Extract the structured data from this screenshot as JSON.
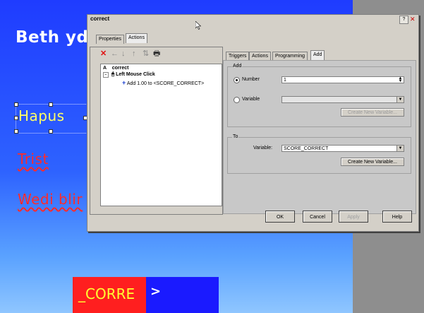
{
  "slide": {
    "title": "Beth ydy",
    "answers": [
      "Hapus",
      "Trist",
      "Wedi blir"
    ],
    "feedback_red": "_CORRE",
    "feedback_blue": ">"
  },
  "dialog": {
    "title": "correct",
    "help_glyph": "?",
    "close_glyph": "✕",
    "outer_tabs": [
      "Properties",
      "Actions"
    ],
    "toolbar_icons": [
      {
        "icon": "delete-x-icon",
        "glyph": "✕"
      },
      {
        "icon": "arrow-left-icon",
        "glyph": "←"
      },
      {
        "icon": "arrow-down-icon",
        "glyph": "↓"
      },
      {
        "icon": "arrow-up-icon",
        "glyph": "↑"
      },
      {
        "icon": "move-icon",
        "glyph": "⇅"
      },
      {
        "icon": "print-icon",
        "glyph": "🖶"
      }
    ],
    "tree": {
      "root_letter": "A",
      "root_label": "correct",
      "event_label": "Left Mouse Click",
      "action_label": "Add 1.00 to <SCORE_CORRECT>"
    },
    "inner_tabs": [
      "Triggers",
      "Actions",
      "Programming",
      "Add"
    ],
    "add_group": {
      "label": "Add",
      "number_label": "Number",
      "number_value": "1",
      "variable_label": "Variable",
      "variable_value": "",
      "create_new_variable_label": "Create New Variable..."
    },
    "to_group": {
      "label": "To",
      "variable_label": "Variable:",
      "variable_value": "SCORE_CORRECT",
      "create_new_variable_label": "Create New Variable..."
    },
    "buttons": {
      "ok": "OK",
      "cancel": "Cancel",
      "apply": "Apply",
      "help": "Help"
    }
  }
}
